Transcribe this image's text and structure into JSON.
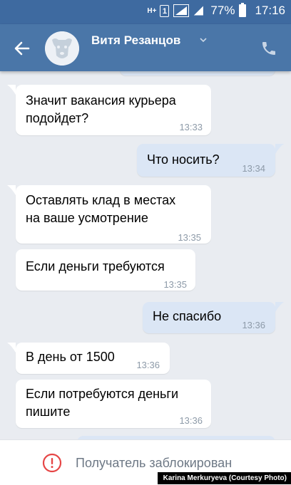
{
  "status_bar": {
    "network": "H+",
    "sim": "1",
    "battery": "77%",
    "time": "17:16"
  },
  "header": {
    "contact_name": "Витя Резанцов"
  },
  "messages": [
    {
      "direction": "in",
      "text_lines": [
        "Значит вакансия курьера",
        "подойдет?"
      ],
      "time": "13:33"
    },
    {
      "direction": "out",
      "text_lines": [
        "Что носить?"
      ],
      "time": "13:34"
    },
    {
      "direction": "in",
      "text_lines": [
        "Оставлять клад в местах",
        "на ваше усмотрение"
      ],
      "time": "13:35"
    },
    {
      "direction": "in",
      "text_lines": [
        "Если деньги требуются"
      ],
      "time": "13:35"
    },
    {
      "direction": "out",
      "text_lines": [
        "Не спасибо"
      ],
      "time": "13:36"
    },
    {
      "direction": "in",
      "text_lines": [
        "В день от 1500"
      ],
      "time": "13:36"
    },
    {
      "direction": "in",
      "text_lines": [
        "Если потребуются деньги",
        "пишите"
      ],
      "time": "13:36"
    }
  ],
  "footer": {
    "blocked_text": "Получатель заблокирован"
  },
  "photo_credit": "Karina Merkuryeva (Courtesy Photo)",
  "colors": {
    "header": "#4a76a8",
    "status_bar": "#3e6aa0",
    "background": "#e9ecf1",
    "outgoing_bubble": "#dbe6f5",
    "warning": "#e64646"
  }
}
